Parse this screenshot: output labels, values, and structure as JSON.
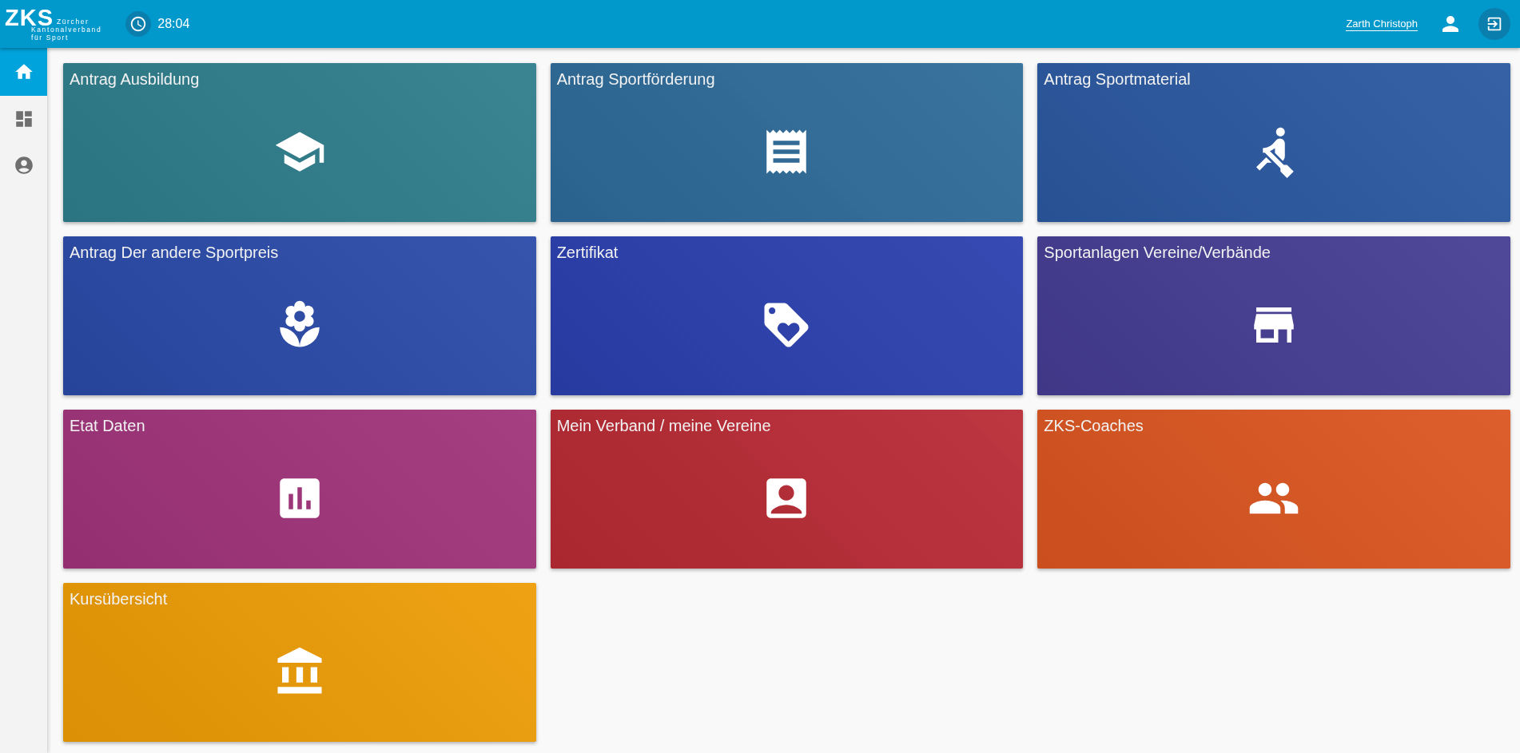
{
  "header": {
    "logo": {
      "mark": "ZKS",
      "line_1": "Zürcher",
      "line_2": "Kantonalverband",
      "line_3": "für Sport"
    },
    "timer": "28:04",
    "user": "Zarth Christoph"
  },
  "sidebar": {
    "items": [
      {
        "kind": "home",
        "selected": true
      },
      {
        "kind": "dashboard",
        "selected": false
      },
      {
        "kind": "account",
        "selected": false
      }
    ]
  },
  "tiles": [
    {
      "title": "Antrag Ausbildung",
      "kind": "school",
      "color": "#2e7d8c"
    },
    {
      "title": "Antrag Sportförderung",
      "kind": "receipt",
      "color": "#2d6b99"
    },
    {
      "title": "Antrag Sportmaterial",
      "kind": "rowing",
      "color": "#2a58a0"
    },
    {
      "title": "Antrag Der andere Sportpreis",
      "kind": "flower",
      "color": "#2a4aa8"
    },
    {
      "title": "Zertifikat",
      "kind": "tag",
      "color": "#2a3fae"
    },
    {
      "title": "Sportanlagen Vereine/Verbände",
      "kind": "store",
      "color": "#453c92"
    },
    {
      "title": "Etat Daten",
      "kind": "chart",
      "color": "#a0337a"
    },
    {
      "title": "Mein Verband / meine Vereine",
      "kind": "contact",
      "color": "#b82a34"
    },
    {
      "title": "ZKS-Coaches",
      "kind": "people",
      "color": "#db5520"
    },
    {
      "title": "Kursübersicht",
      "kind": "bank",
      "color": "#ed9c05"
    }
  ]
}
